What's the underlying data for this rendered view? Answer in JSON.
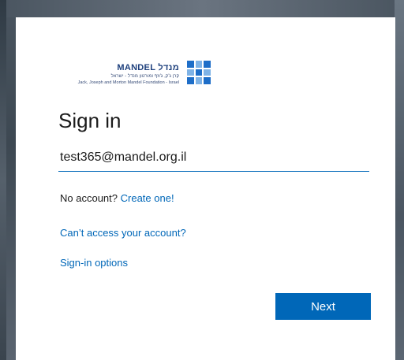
{
  "logo": {
    "main_text": "MANDEL מנדל",
    "sub_text": "קרן ג'ק, ג'וזף ומורטון מנדל - ישראל",
    "english_text": "Jack, Joseph and Morton Mandel Foundation - Israel"
  },
  "signin": {
    "title": "Sign in",
    "email_value": "test365@mandel.org.il",
    "no_account_text": "No account?",
    "create_link": "Create one!",
    "cant_access_link": "Can’t access your account?",
    "options_link": "Sign-in options",
    "next_label": "Next"
  },
  "colors": {
    "accent": "#0067b8"
  }
}
